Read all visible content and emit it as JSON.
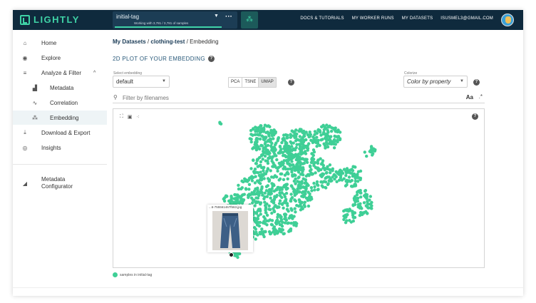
{
  "header": {
    "logo_text": "LIGHTLY",
    "tag_select": {
      "value": "initial-tag",
      "subtitle": "Working with 3,781 / 3,781 of samples"
    },
    "nav": [
      "DOCS & TUTORIALS",
      "MY WORKER RUNS",
      "MY DATASETS",
      "ISUSMEL3@GMAIL.COM"
    ]
  },
  "sidebar": {
    "items": [
      {
        "label": "Home",
        "icon": "home-icon"
      },
      {
        "label": "Explore",
        "icon": "compass-icon"
      },
      {
        "label": "Analyze & Filter",
        "icon": "filter-icon"
      },
      {
        "label": "Metadata",
        "icon": "bar-chart-icon"
      },
      {
        "label": "Correlation",
        "icon": "correlation-icon"
      },
      {
        "label": "Embedding",
        "icon": "embedding-icon"
      },
      {
        "label": "Download & Export",
        "icon": "download-icon"
      },
      {
        "label": "Insights",
        "icon": "eye-icon"
      }
    ],
    "configurator": {
      "line1": "Metadata",
      "line2": "Configurator",
      "icon": "configurator-icon"
    }
  },
  "breadcrumb": {
    "root": "My Datasets",
    "dataset": "clothing-test",
    "current": "Embedding",
    "sep": "/"
  },
  "page_title": "2D PLOT OF YOUR EMBEDDING",
  "embedding_select": {
    "label": "Select embedding",
    "value": "default"
  },
  "algorithms": {
    "options": [
      "PCA",
      "TSNE",
      "UMAP"
    ],
    "selected": "UMAP"
  },
  "colorize": {
    "label": "Colorize",
    "value": "Color by property"
  },
  "filter": {
    "placeholder": "Filter by filenames",
    "case_label": "Aa"
  },
  "plot": {
    "thumbnail_name": "...6-755561467f563.jpg",
    "point_color": "#3fcf96"
  },
  "legend": {
    "label": "samples in initial-tag"
  },
  "colors": {
    "topbar": "#0f2a3d",
    "accent": "#3fd2a6",
    "points": "#3fcf96"
  }
}
